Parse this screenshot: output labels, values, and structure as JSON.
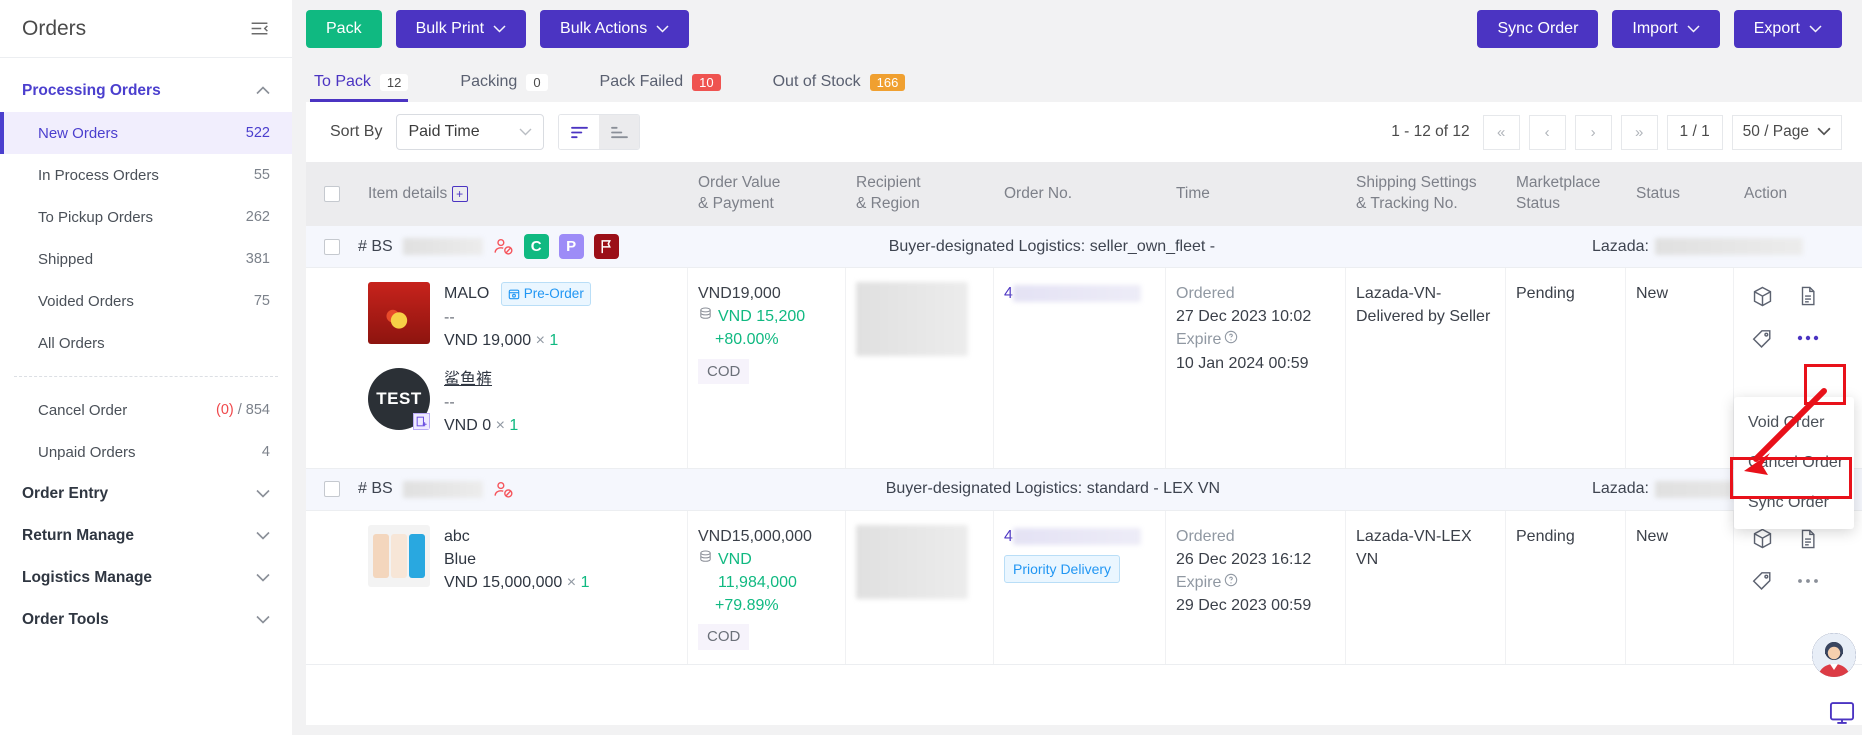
{
  "sidebar": {
    "title": "Orders",
    "collapse_icon": "collapse-panel-icon",
    "groups": [
      {
        "label": "Processing Orders",
        "expanded": true,
        "chevron": "chevron-up-icon",
        "items": [
          {
            "label": "New Orders",
            "count": "522",
            "active": true
          },
          {
            "label": "In Process Orders",
            "count": "55",
            "active": false
          },
          {
            "label": "To Pickup Orders",
            "count": "262",
            "active": false
          },
          {
            "label": "Shipped",
            "count": "381",
            "active": false
          },
          {
            "label": "Voided Orders",
            "count": "75",
            "active": false
          },
          {
            "label": "All Orders",
            "count": "",
            "active": false
          }
        ]
      }
    ],
    "secondary_items": [
      {
        "label": "Cancel Order",
        "count_red": "(0)",
        "count_rest": " / 854"
      },
      {
        "label": "Unpaid Orders",
        "count": "4"
      }
    ],
    "collapsed_groups": [
      {
        "label": "Order Entry",
        "chevron": "chevron-down-icon"
      },
      {
        "label": "Return Manage",
        "chevron": "chevron-down-icon"
      },
      {
        "label": "Logistics Manage",
        "chevron": "chevron-down-icon"
      },
      {
        "label": "Order Tools",
        "chevron": "chevron-down-icon"
      }
    ]
  },
  "toolbar": {
    "pack": "Pack",
    "bulk_print": "Bulk Print",
    "bulk_actions": "Bulk Actions",
    "sync_order": "Sync Order",
    "import": "Import",
    "export": "Export",
    "caret": "⌄"
  },
  "tabs": [
    {
      "label": "To Pack",
      "count": "12",
      "active": true,
      "style": "plain"
    },
    {
      "label": "Packing",
      "count": "0",
      "active": false,
      "style": "plain"
    },
    {
      "label": "Pack Failed",
      "count": "10",
      "active": false,
      "style": "red"
    },
    {
      "label": "Out of Stock",
      "count": "166",
      "active": false,
      "style": "orange"
    }
  ],
  "sortbar": {
    "sort_by_label": "Sort By",
    "sort_value": "Paid Time",
    "sort_asc_icon": "sort-ascending-icon",
    "sort_desc_icon": "sort-descending-icon",
    "page_info": "1 - 12 of 12",
    "first_page": "«",
    "prev_page": "‹",
    "next_page": "›",
    "last_page": "»",
    "page_number": "1 / 1",
    "page_size": "50 / Page"
  },
  "table": {
    "headers": {
      "item_details": "Item details",
      "order_value_1": "Order Value",
      "order_value_2": "& Payment",
      "recipient_1": "Recipient",
      "recipient_2": "& Region",
      "order_no": "Order No.",
      "time": "Time",
      "shipping_1": "Shipping Settings",
      "shipping_2": "& Tracking No.",
      "marketplace_1": "Marketplace",
      "marketplace_2": "Status",
      "status": "Status",
      "action": "Action"
    },
    "orders": [
      {
        "prefix": "# BS",
        "logistics": "Buyer-designated Logistics: seller_own_fleet -",
        "marketplace_label": "Lazada:",
        "badges": [
          "user-blocked-icon",
          "C",
          "P",
          "flag-icon"
        ],
        "products": [
          {
            "name": "MALO",
            "tag": "Pre-Order",
            "variant": "--",
            "price": "VND 19,000",
            "times": "×",
            "qty": "1",
            "thumb": "noodle-packet-image"
          },
          {
            "name": "鲨鱼裤",
            "tag": "",
            "variant": "--",
            "price": "VND 0",
            "times": "×",
            "qty": "1",
            "thumb": "test-logo-image"
          }
        ],
        "order_value": "VND19,000",
        "settlement": "VND 15,200",
        "margin": "+80.00%",
        "payment": "COD",
        "order_no_prefix": "4",
        "time_label_1": "Ordered",
        "time_value_1": "27 Dec 2023 10:02",
        "time_label_2": "Expire",
        "time_value_2": "10 Jan 2024 00:59",
        "shipping": "Lazada-VN-Delivered by Seller",
        "marketplace_status": "Pending",
        "status": "New",
        "priority_tag": ""
      },
      {
        "prefix": "# BS",
        "logistics": "Buyer-designated Logistics: standard - LEX VN",
        "marketplace_label": "Lazada:",
        "badges": [
          "user-blocked-icon"
        ],
        "products": [
          {
            "name": "abc",
            "tag": "",
            "variant": "Blue",
            "price": "VND 15,000,000",
            "times": "×",
            "qty": "1",
            "thumb": "phones-image"
          }
        ],
        "order_value": "VND15,000,000",
        "settlement": "VND 11,984,000",
        "margin": "+79.89%",
        "payment": "COD",
        "order_no_prefix": "4",
        "time_label_1": "Ordered",
        "time_value_1": "26 Dec 2023 16:12",
        "time_label_2": "Expire",
        "time_value_2": "29 Dec 2023 00:59",
        "shipping": "Lazada-VN-LEX VN",
        "marketplace_status": "Pending",
        "status": "New",
        "priority_tag": "Priority Delivery"
      }
    ],
    "row_action_icons": [
      "package-icon",
      "document-icon",
      "tag-icon",
      "more-options-icon"
    ]
  },
  "context_menu": {
    "items": [
      {
        "label": "Void Order",
        "highlighted": false
      },
      {
        "label": "Cancel Order",
        "highlighted": true
      },
      {
        "label": "Sync Order",
        "highlighted": false
      }
    ]
  },
  "colors": {
    "brand_purple": "#4b34c2",
    "green": "#10b981",
    "red_highlight": "#e8111a",
    "tab_red_badge": "#ef5350",
    "tab_orange_badge": "#f0a030"
  }
}
